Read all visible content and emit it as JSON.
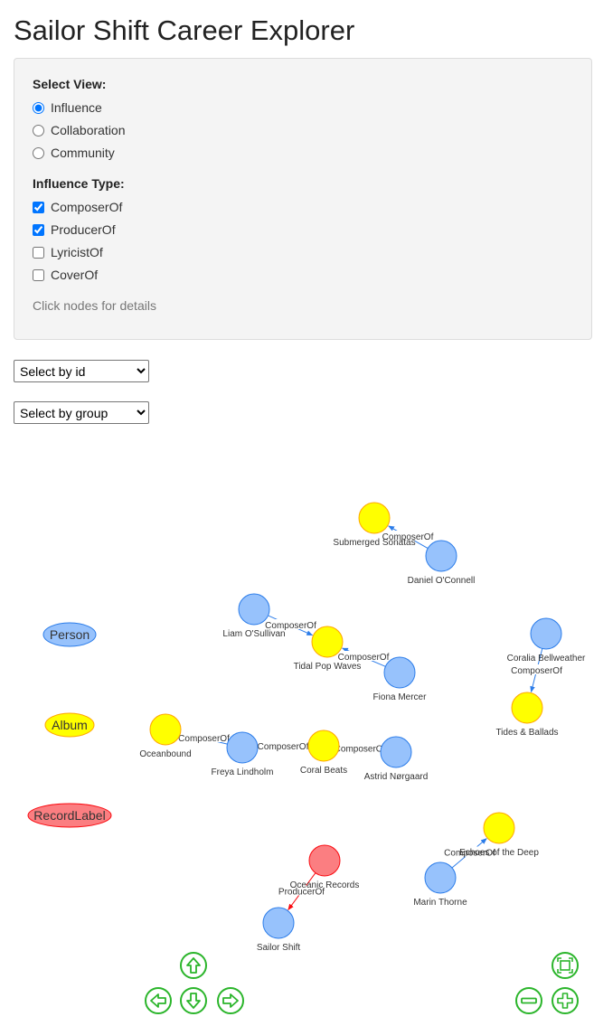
{
  "page": {
    "title": "Sailor Shift Career Explorer"
  },
  "controls": {
    "view_label": "Select View:",
    "views": [
      {
        "label": "Influence",
        "checked": true
      },
      {
        "label": "Collaboration",
        "checked": false
      },
      {
        "label": "Community",
        "checked": false
      }
    ],
    "influence_label": "Influence Type:",
    "influence_types": [
      {
        "label": "ComposerOf",
        "checked": true
      },
      {
        "label": "ProducerOf",
        "checked": true
      },
      {
        "label": "LyricistOf",
        "checked": false
      },
      {
        "label": "CoverOf",
        "checked": false
      }
    ],
    "hint": "Click nodes for details"
  },
  "selects": {
    "by_id": "Select by id",
    "by_group": "Select by group"
  },
  "legend": [
    {
      "label": "Person",
      "color": "#97c2fc",
      "border": "#2b7ce9"
    },
    {
      "label": "Album",
      "color": "#ffff00",
      "border": "#ffa500"
    },
    {
      "label": "RecordLabel",
      "color": "#fb7e81",
      "border": "#fa0a10"
    }
  ],
  "graph": {
    "nodes": [
      {
        "id": "submerged",
        "label": "Submerged Sonatas",
        "group": "Album"
      },
      {
        "id": "oconnell",
        "label": "Daniel O'Connell",
        "group": "Person"
      },
      {
        "id": "liam",
        "label": "Liam O'Sullivan",
        "group": "Person"
      },
      {
        "id": "tidalpop",
        "label": "Tidal Pop Waves",
        "group": "Album"
      },
      {
        "id": "fiona",
        "label": "Fiona Mercer",
        "group": "Person"
      },
      {
        "id": "coralia",
        "label": "Coralia Bellweather",
        "group": "Person"
      },
      {
        "id": "tides",
        "label": "Tides & Ballads",
        "group": "Album"
      },
      {
        "id": "oceanbound",
        "label": "Oceanbound",
        "group": "Album"
      },
      {
        "id": "freya",
        "label": "Freya Lindholm",
        "group": "Person"
      },
      {
        "id": "coral",
        "label": "Coral Beats",
        "group": "Album"
      },
      {
        "id": "astrid",
        "label": "Astrid Nørgaard",
        "group": "Person"
      },
      {
        "id": "echoes",
        "label": "Echoes of the Deep",
        "group": "Album"
      },
      {
        "id": "marin",
        "label": "Marin Thorne",
        "group": "Person"
      },
      {
        "id": "oceanic",
        "label": "Oceanic Records",
        "group": "RecordLabel"
      },
      {
        "id": "sailor",
        "label": "Sailor Shift",
        "group": "Person"
      }
    ],
    "edges": [
      {
        "from": "oconnell",
        "to": "submerged",
        "label": "ComposerOf"
      },
      {
        "from": "liam",
        "to": "tidalpop",
        "label": "ComposerOf"
      },
      {
        "from": "fiona",
        "to": "tidalpop",
        "label": "ComposerOf"
      },
      {
        "from": "coralia",
        "to": "tides",
        "label": "ComposerOf"
      },
      {
        "from": "freya",
        "to": "oceanbound",
        "label": "ComposerOf"
      },
      {
        "from": "freya",
        "to": "coral",
        "label": "ComposerOf"
      },
      {
        "from": "astrid",
        "to": "coral",
        "label": "ComposerOf"
      },
      {
        "from": "marin",
        "to": "echoes",
        "label": "ComposerOf"
      },
      {
        "from": "oceanic",
        "to": "sailor",
        "label": "ProducerOf"
      }
    ]
  },
  "nav_icons": [
    "up-arrow-icon",
    "left-arrow-icon",
    "down-arrow-icon",
    "right-arrow-icon",
    "zoom-extends-icon",
    "zoom-out-icon",
    "zoom-in-icon"
  ]
}
